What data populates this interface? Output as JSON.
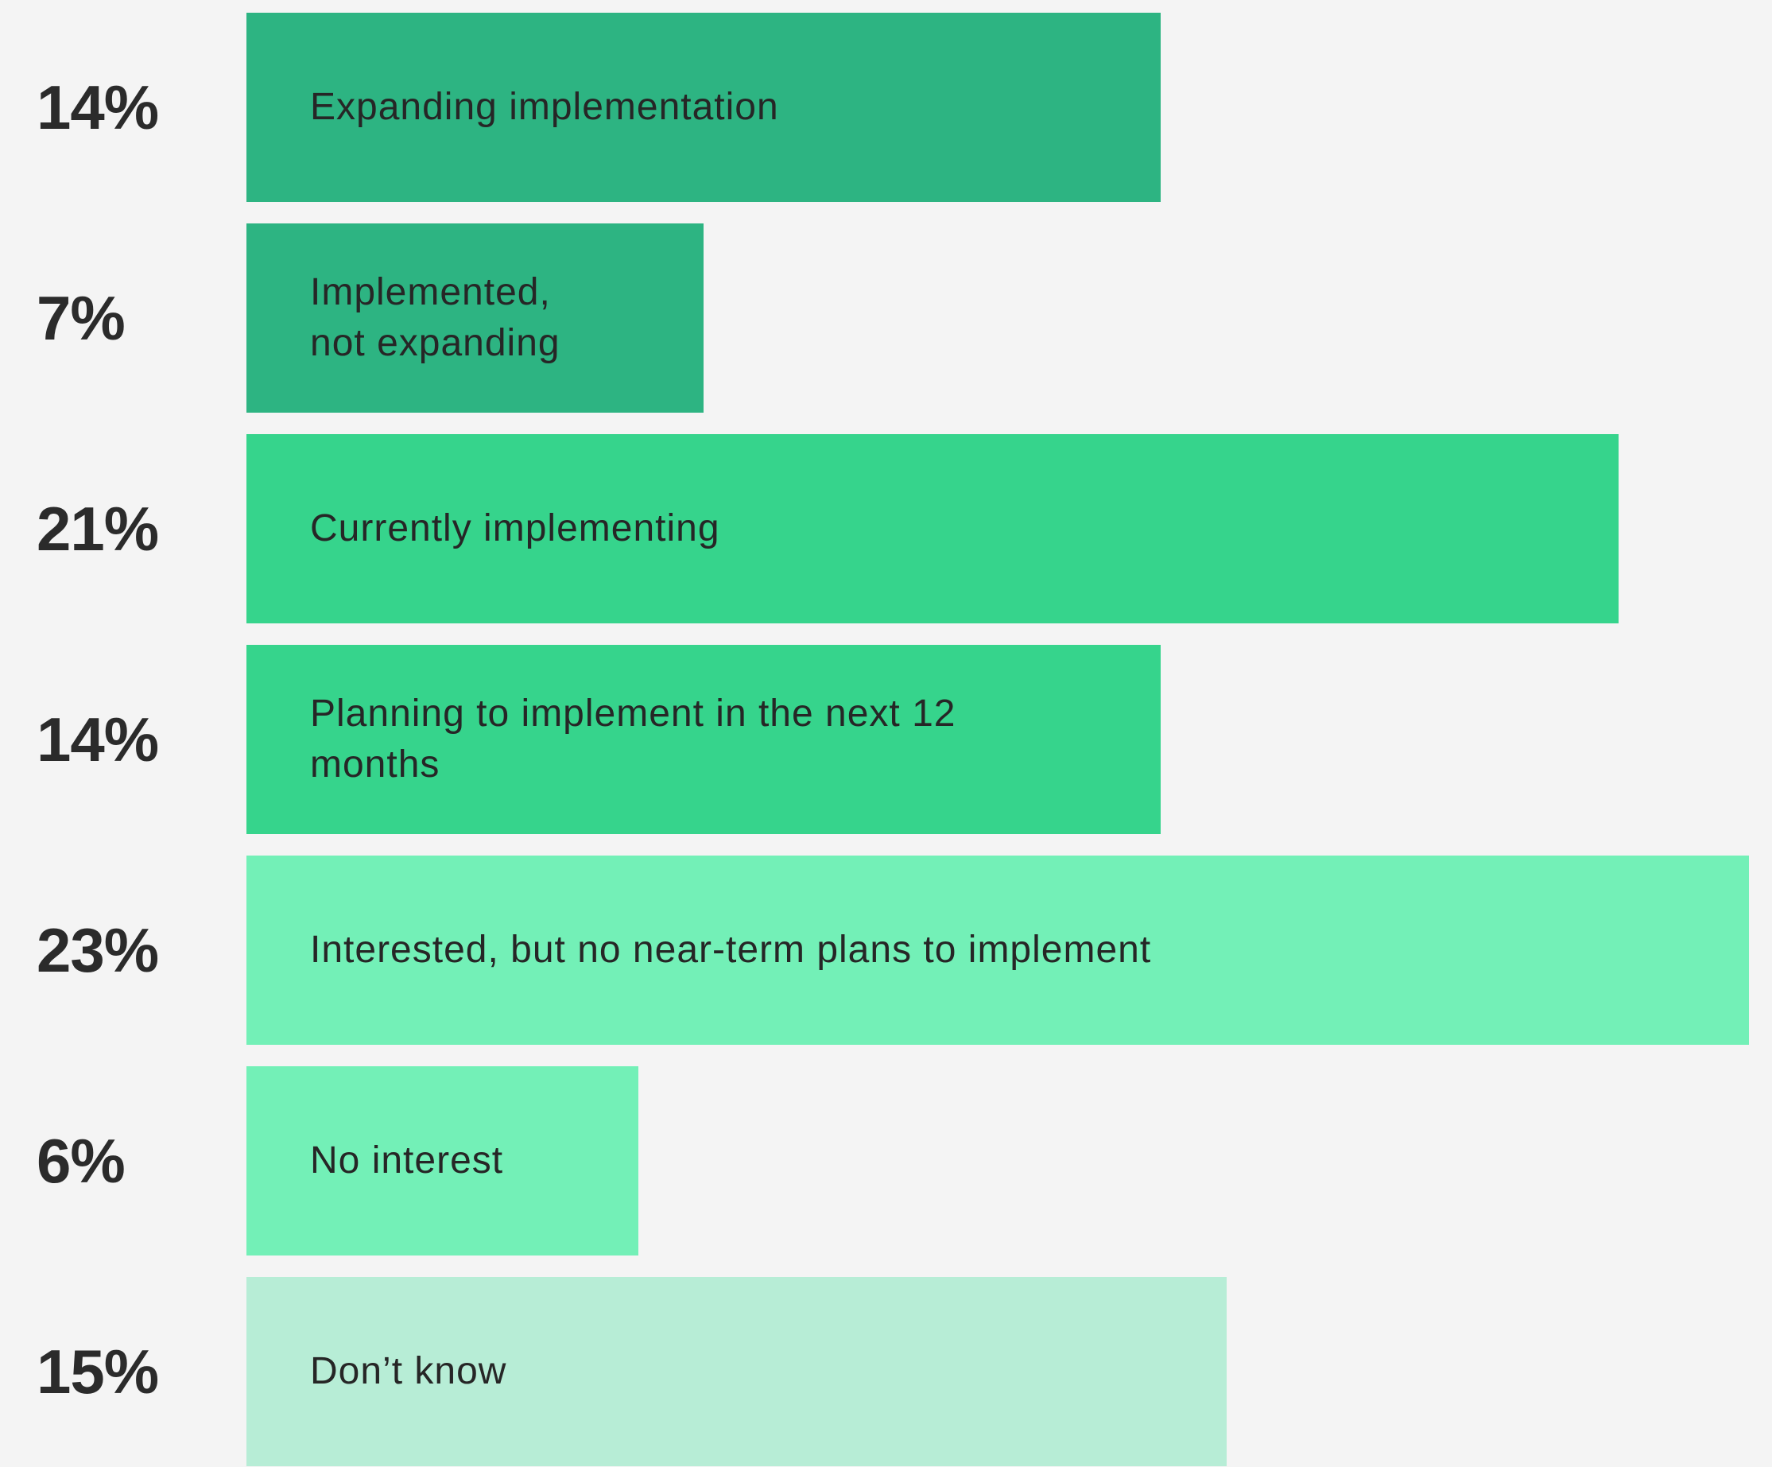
{
  "chart_data": {
    "type": "bar",
    "orientation": "horizontal",
    "title": "",
    "xlabel": "",
    "ylabel": "",
    "xlim": [
      0,
      23
    ],
    "grid": false,
    "legend": "none",
    "categories": [
      "Expanding implementation",
      "Implemented,\nnot expanding",
      "Currently implementing",
      "Planning to implement in the next 12\nmonths",
      "Interested, but no near-term plans to implement",
      "No interest",
      "Don’t know"
    ],
    "values": [
      14,
      7,
      21,
      14,
      23,
      6,
      15
    ],
    "value_labels": [
      "14%",
      "7%",
      "21%",
      "14%",
      "23%",
      "6%",
      "15%"
    ],
    "colors": [
      "#2db482",
      "#2db482",
      "#36d48c",
      "#36d48c",
      "#73f0b7",
      "#73f0b7",
      "#b7edd6"
    ]
  }
}
